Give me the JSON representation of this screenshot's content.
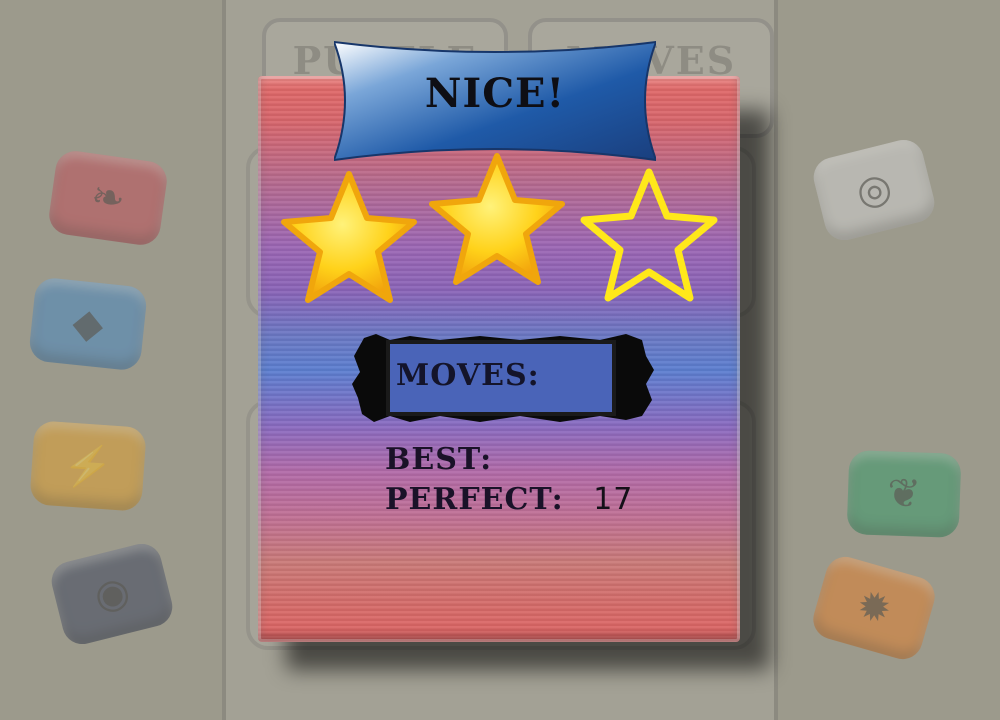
{
  "background_board": {
    "tabs": [
      {
        "label": "PUZZLE"
      },
      {
        "label": "MOVES"
      }
    ]
  },
  "side_tiles": [
    {
      "color": "#c0505a",
      "icon": "dragon-icon"
    },
    {
      "color": "#4a88c0",
      "icon": "water-drop-icon"
    },
    {
      "color": "#e0a030",
      "icon": "lightning-icon"
    },
    {
      "color": "#404860",
      "icon": "shield-icon"
    },
    {
      "color": "#d0d0d0",
      "icon": "spiral-icon"
    },
    {
      "color": "#3a9a6a",
      "icon": "leaf-icon"
    },
    {
      "color": "#e08030",
      "icon": "beetle-icon"
    }
  ],
  "result_dialog": {
    "title": "NICE!",
    "stars_earned": 2,
    "stars_total": 3,
    "moves_label": "MOVES:",
    "moves_value": "",
    "best_label": "BEST:",
    "best_value": "",
    "perfect_label": "PERFECT:",
    "perfect_value": "17"
  },
  "colors": {
    "banner_blue": "#1f5aa8",
    "star_gold": "#ffd21a",
    "star_outline": "#ffe81a"
  }
}
